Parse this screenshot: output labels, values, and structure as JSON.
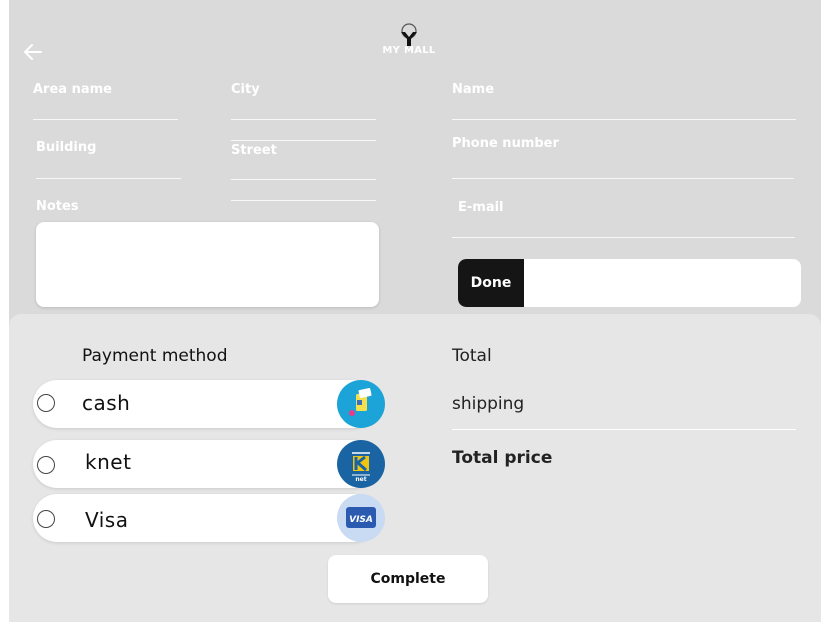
{
  "header": {
    "brand": "MY MALL",
    "back_icon": "arrow-left-icon"
  },
  "address_form": {
    "area_name_label": "Area name",
    "city_label": "City",
    "building_label": "Building",
    "street_label": "Street",
    "notes_label": "Notes",
    "notes_value": ""
  },
  "contact_form": {
    "name_label": "Name",
    "phone_label": "Phone number",
    "email_label": "E-mail",
    "done_label": "Done",
    "done_input_value": ""
  },
  "payment": {
    "title": "Payment method",
    "options": [
      {
        "label": "cash",
        "icon": "cash-icon",
        "selected": false
      },
      {
        "label": "knet",
        "icon": "knet-icon",
        "selected": false
      },
      {
        "label": "Visa",
        "icon": "visa-icon",
        "selected": false
      }
    ]
  },
  "summary": {
    "total_label": "Total",
    "shipping_label": "shipping",
    "total_price_label": "Total price"
  },
  "actions": {
    "complete_label": "Complete"
  },
  "colors": {
    "background": "#dbdada",
    "panel": "#e6e6e6",
    "done_button": "#151515",
    "cash_icon_bg": "#1ca3d8",
    "knet_icon_bg": "#1a64a3",
    "visa_icon_bg": "#c9daf3"
  }
}
